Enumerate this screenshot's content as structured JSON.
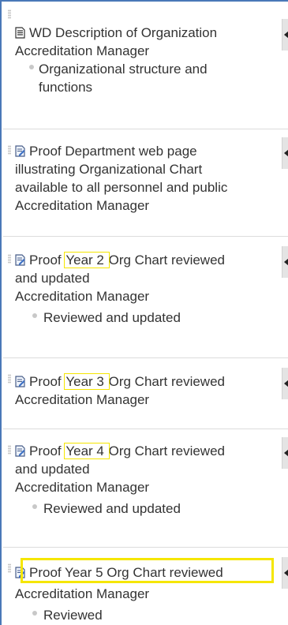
{
  "items": [
    {
      "title": "WD Description of Organization",
      "owner": "Accreditation Manager",
      "bullet_lines": [
        "Organizational structure and",
        "functions"
      ]
    },
    {
      "title_lines": [
        "Proof Department web page",
        "illustrating Organizational Chart",
        "available to all personnel and public"
      ],
      "owner": "Accreditation Manager"
    },
    {
      "title_prefix": "Proof ",
      "title_mark": "Year 2 ",
      "title_suffix": "Org Chart reviewed",
      "title_line2": "and updated",
      "owner": "Accreditation Manager",
      "bullet": "Reviewed and updated"
    },
    {
      "title_prefix": "Proof ",
      "title_mark": "Year 3 ",
      "title_suffix": "Org Chart reviewed",
      "owner": "Accreditation Manager"
    },
    {
      "title_prefix": "Proof ",
      "title_mark": "Year 4 ",
      "title_suffix": "Org Chart reviewed",
      "title_line2": "and updated",
      "owner": "Accreditation Manager",
      "bullet": "Reviewed and updated"
    },
    {
      "title": "Proof Year 5 Org Chart reviewed",
      "owner": "Accreditation Manager",
      "bullet": "Reviewed"
    }
  ],
  "colors": {
    "frame_border": "#4a78b8",
    "highlight": "#f5e600",
    "text": "#333333"
  },
  "icons": {
    "item_1": "text-document-icon",
    "items_2_to_6": "edit-document-icon",
    "side_buttons": "caret-left-icon",
    "drag_handles": "drag-grip-icon"
  }
}
